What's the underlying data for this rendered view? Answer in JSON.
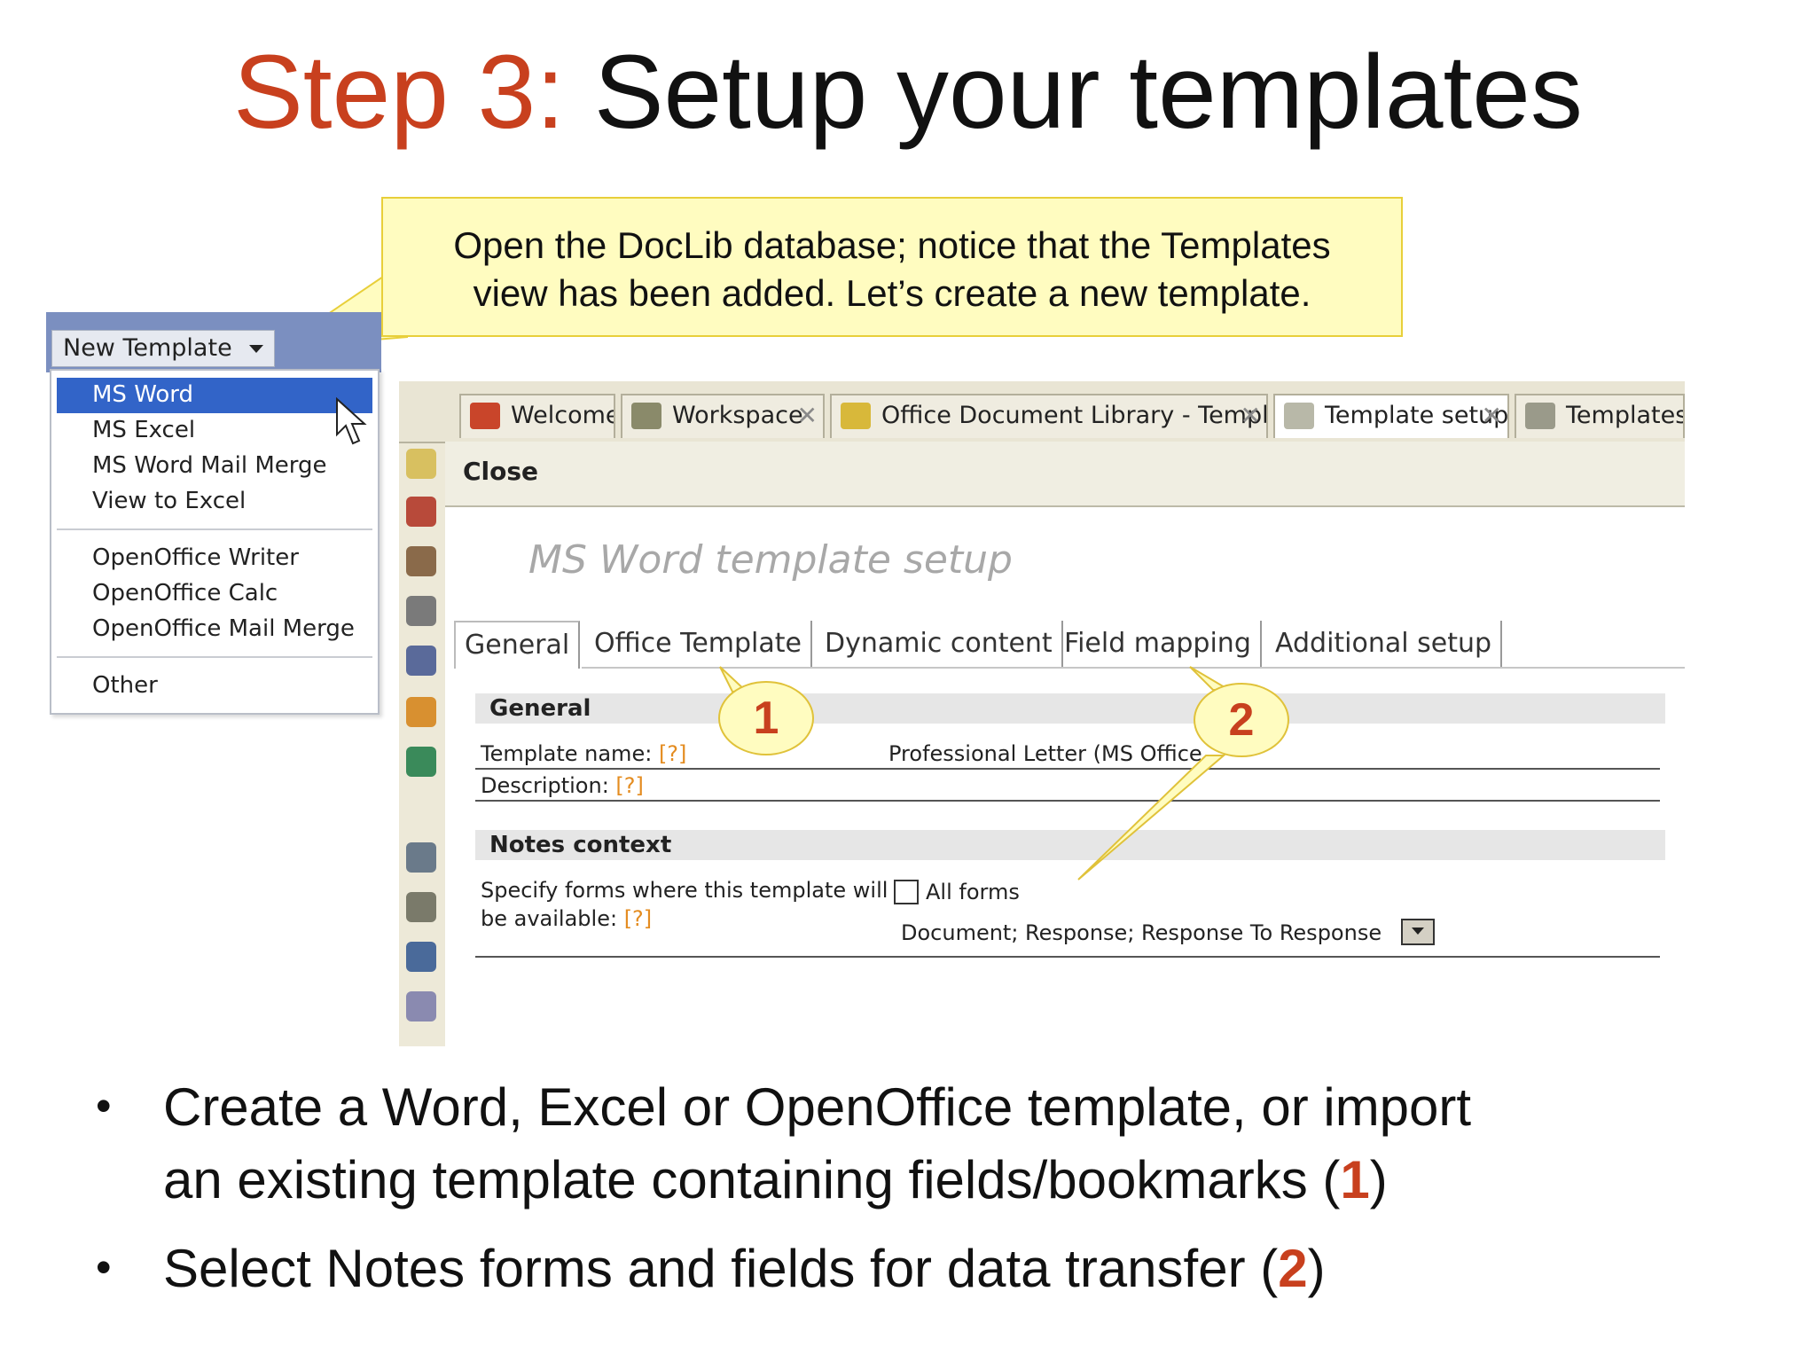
{
  "slide": {
    "title_step": "Step 3:",
    "title_rest": "Setup your templates",
    "callout_line1": "Open the DocLib database; notice that the Templates",
    "callout_line2": "view has been added. Let’s create a new template."
  },
  "menu": {
    "button_label": "New Template",
    "items": [
      "MS Word",
      "MS Excel",
      "MS Word Mail Merge",
      "View to Excel",
      "OpenOffice Writer",
      "OpenOffice Calc",
      "OpenOffice Mail Merge",
      "Other"
    ],
    "selected": "MS Word"
  },
  "app": {
    "tabs": [
      {
        "label": "Welcome",
        "icon": "home-icon"
      },
      {
        "label": "Workspace",
        "icon": "workspace-icon"
      },
      {
        "label": "Office Document Library - Templ...",
        "icon": "library-icon"
      },
      {
        "label": "Template setup",
        "icon": "template-setup-icon"
      },
      {
        "label": "Templates",
        "icon": "templates-icon"
      }
    ],
    "close_label": "Close",
    "heading": "MS Word template setup",
    "form_tabs": [
      "General",
      "Office Template",
      "Dynamic content",
      "Field mapping",
      "Additional setup"
    ],
    "section_general": "General",
    "template_name_label": "Template name:",
    "template_name_value": "Professional Letter (MS Office",
    "description_label": "Description:",
    "help_mark": "[?]",
    "section_notes": "Notes context",
    "forms_label_line1": "Specify forms where this template will",
    "forms_label_line2": "be available:",
    "all_forms_label": "All forms",
    "forms_value": "Document; Response; Response To Response"
  },
  "bubbles": {
    "one": "1",
    "two": "2"
  },
  "bullets": {
    "b1_line1": "Create a Word, Excel or OpenOffice template, or import",
    "b1_line2_pre": "an existing template containing fields/bookmarks (",
    "b1_ref": "1",
    "b1_close": ")",
    "b2_pre": "Select Notes forms and fields for data transfer (",
    "b2_ref": "2",
    "b2_close": ")"
  },
  "colors": {
    "accent_orange": "#c8401e",
    "callout_fill": "#fffcc0",
    "menu_selection": "#3264c8"
  }
}
